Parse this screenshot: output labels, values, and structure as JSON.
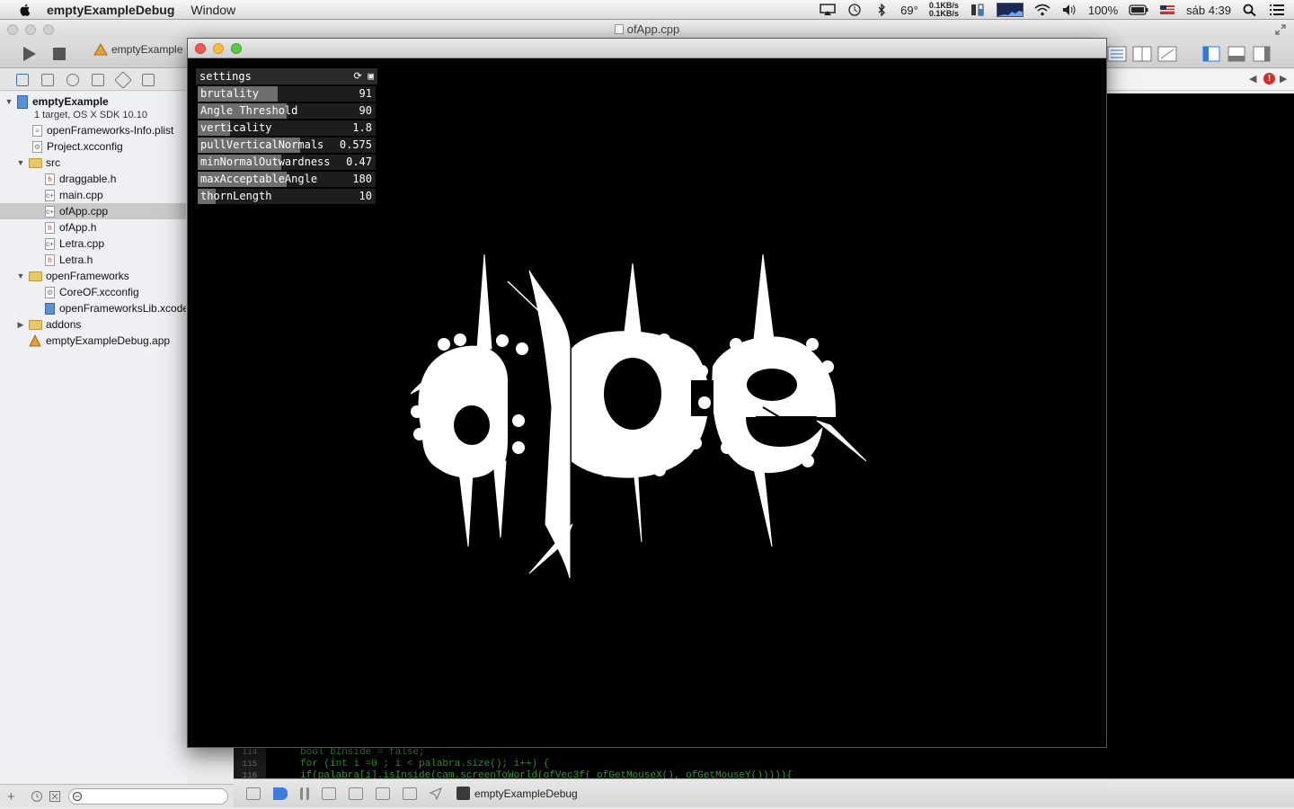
{
  "menubar": {
    "app_name": "emptyExampleDebug",
    "menus": [
      "Window"
    ],
    "temperature": "69°",
    "net_up": "0.1KB/s",
    "net_down": "0.1KB/s",
    "battery": "100%",
    "clock": "sáb 4:39"
  },
  "xcode": {
    "window_title": "ofApp.cpp",
    "scheme": "emptyExample",
    "navigator": {
      "project": "emptyExample",
      "project_subtitle": "1 target, OS X SDK 10.10",
      "items": [
        {
          "label": "openFrameworks-Info.plist",
          "type": "plist"
        },
        {
          "label": "Project.xcconfig",
          "type": "config"
        },
        {
          "label": "src",
          "type": "folder"
        },
        {
          "label": "draggable.h",
          "type": "h"
        },
        {
          "label": "main.cpp",
          "type": "cpp"
        },
        {
          "label": "ofApp.cpp",
          "type": "cpp"
        },
        {
          "label": "ofApp.h",
          "type": "h"
        },
        {
          "label": "Letra.cpp",
          "type": "cpp"
        },
        {
          "label": "Letra.h",
          "type": "h"
        },
        {
          "label": "openFrameworks",
          "type": "folder"
        },
        {
          "label": "CoreOF.xcconfig",
          "type": "config"
        },
        {
          "label": "openFrameworksLib.xcodeproj",
          "type": "proj"
        },
        {
          "label": "addons",
          "type": "folder"
        },
        {
          "label": "emptyExampleDebug.app",
          "type": "app"
        }
      ]
    },
    "code": [
      {
        "line": "114",
        "text": "bool bInside = false;"
      },
      {
        "line": "115",
        "text": "for (int i =0 ; i < palabra.size(); i++) {"
      },
      {
        "line": "116",
        "text": "if(palabra[i].isInside(cam.screenToWorld(ofVec3f( ofGetMouseX(), ofGetMouseY())))){"
      }
    ],
    "debug_target": "emptyExampleDebug"
  },
  "app_window": {
    "gui": {
      "title": "settings",
      "sliders": [
        {
          "name": "brutality",
          "value": "91",
          "fill": 0.45
        },
        {
          "name": "Angle Threshold",
          "value": "90",
          "fill": 0.5
        },
        {
          "name": "verticality",
          "value": "1.8",
          "fill": 0.18
        },
        {
          "name": "pullVerticalNormals",
          "value": "0.575",
          "fill": 0.575
        },
        {
          "name": "minNormalOutwardness",
          "value": "0.47",
          "fill": 0.47
        },
        {
          "name": "maxAcceptableAngle",
          "value": "180",
          "fill": 0.5
        },
        {
          "name": "thornLength",
          "value": "10",
          "fill": 0.1
        }
      ]
    },
    "artwork_text": "ape"
  },
  "colors": {
    "gui_fill": "#6e6e6e",
    "code_green": "#2fa02f",
    "selection": "#c9c9c9",
    "accent_blue": "#2f7ad8"
  }
}
